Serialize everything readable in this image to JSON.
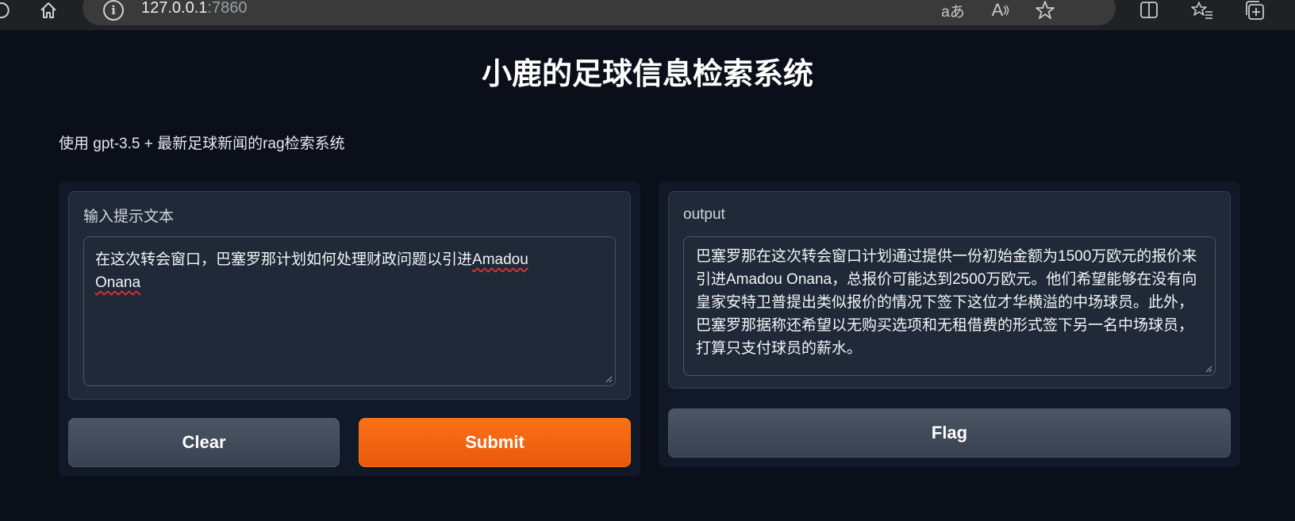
{
  "browser": {
    "url_host": "127.0.0.1",
    "url_port": ":7860",
    "info_glyph": "i",
    "read_aloud_glyph": "aあ",
    "reader_glyph": "A"
  },
  "page": {
    "title": "小鹿的足球信息检索系统",
    "description": "使用 gpt-3.5 + 最新足球新闻的rag检索系统"
  },
  "input": {
    "label": "输入提示文本",
    "value_main": "在这次转会窗口，巴塞罗那计划如何处理财政问题以引进",
    "value_name1": "Amadou",
    "value_name2": "Onana"
  },
  "output": {
    "label": "output",
    "value": "巴塞罗那在这次转会窗口计划通过提供一份初始金额为1500万欧元的报价来引进Amadou Onana，总报价可能达到2500万欧元。他们希望能够在没有向皇家安特卫普提出类似报价的情况下签下这位才华横溢的中场球员。此外，巴塞罗那据称还希望以无购买选项和无租借费的形式签下另一名中场球员，打算只支付球员的薪水。"
  },
  "buttons": {
    "clear": "Clear",
    "submit": "Submit",
    "flag": "Flag"
  },
  "colors": {
    "background": "#0b0f19",
    "panel": "#111827",
    "block": "#1f2937",
    "primary": "#f97316",
    "secondary": "#4b5563"
  }
}
